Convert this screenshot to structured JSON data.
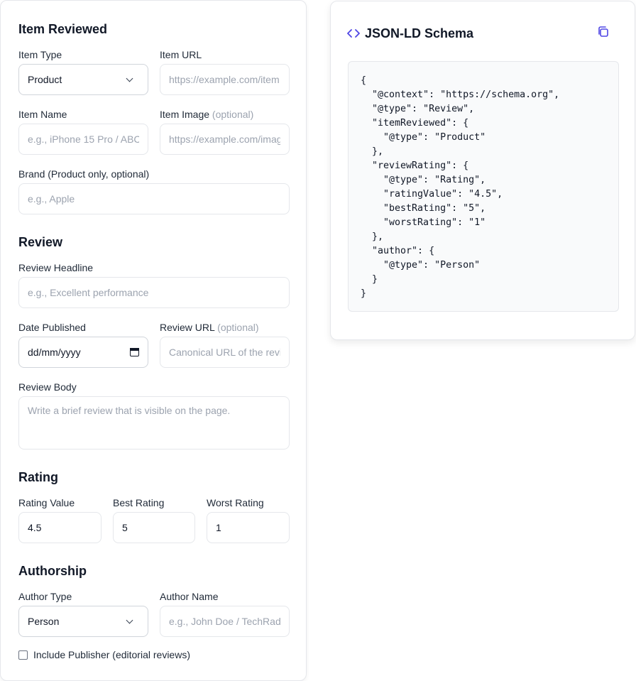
{
  "form": {
    "item_reviewed": {
      "title": "Item Reviewed",
      "item_type_label": "Item Type",
      "item_type_value": "Product",
      "item_url_label": "Item URL",
      "item_url_placeholder": "https://example.com/item",
      "item_name_label": "Item Name",
      "item_name_placeholder": "e.g., iPhone 15 Pro / ABC",
      "item_image_label": "Item Image",
      "item_image_optional": "(optional)",
      "item_image_placeholder": "https://example.com/image",
      "brand_label": "Brand (Product only, optional)",
      "brand_placeholder": "e.g., Apple"
    },
    "review": {
      "title": "Review",
      "headline_label": "Review Headline",
      "headline_placeholder": "e.g., Excellent performance",
      "date_label": "Date Published",
      "date_value": "dd/mm/yyyy",
      "review_url_label": "Review URL",
      "review_url_optional": "(optional)",
      "review_url_placeholder": "Canonical URL of the review",
      "body_label": "Review Body",
      "body_placeholder": "Write a brief review that is visible on the page."
    },
    "rating": {
      "title": "Rating",
      "value_label": "Rating Value",
      "value": "4.5",
      "best_label": "Best Rating",
      "best": "5",
      "worst_label": "Worst Rating",
      "worst": "1"
    },
    "authorship": {
      "title": "Authorship",
      "author_type_label": "Author Type",
      "author_type_value": "Person",
      "author_name_label": "Author Name",
      "author_name_placeholder": "e.g., John Doe / TechRadar",
      "publisher_checkbox_label": "Include Publisher (editorial reviews)",
      "publisher_checked": false
    }
  },
  "schema_panel": {
    "title": "JSON-LD Schema",
    "title_icon": "code-icon",
    "copy_icon": "copy-icon",
    "accent_color": "#4f46e5",
    "code": "{\n  \"@context\": \"https://schema.org\",\n  \"@type\": \"Review\",\n  \"itemReviewed\": {\n    \"@type\": \"Product\"\n  },\n  \"reviewRating\": {\n    \"@type\": \"Rating\",\n    \"ratingValue\": \"4.5\",\n    \"bestRating\": \"5\",\n    \"worstRating\": \"1\"\n  },\n  \"author\": {\n    \"@type\": \"Person\"\n  }\n}"
  }
}
